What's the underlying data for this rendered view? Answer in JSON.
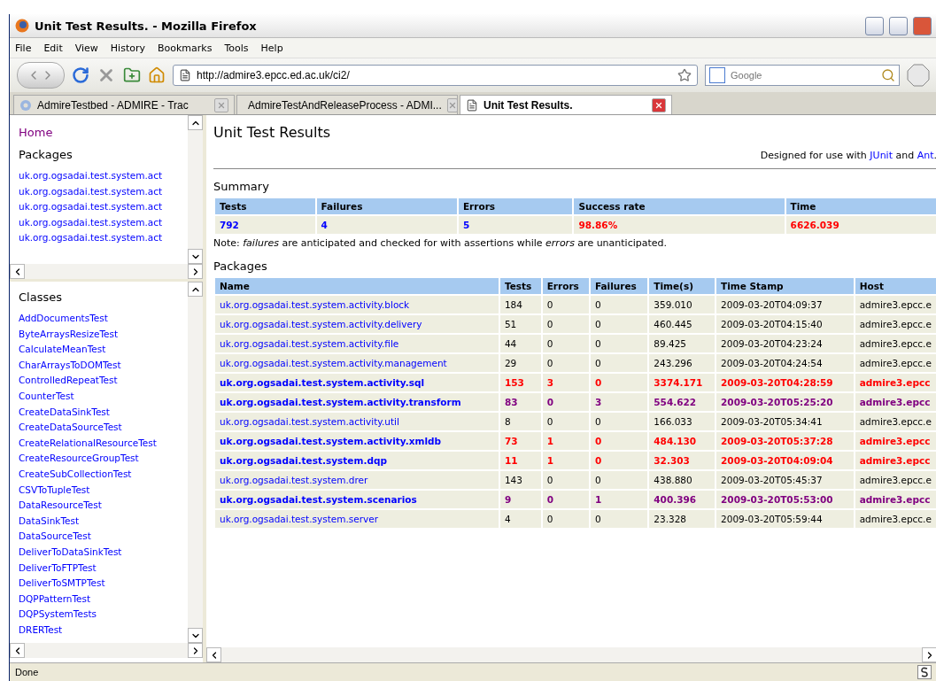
{
  "window": {
    "title": "Unit Test Results. - Mozilla Firefox"
  },
  "menu": [
    "File",
    "Edit",
    "View",
    "History",
    "Bookmarks",
    "Tools",
    "Help"
  ],
  "toolbar": {
    "url": "http://admire3.epcc.ed.ac.uk/ci2/",
    "search_placeholder": "Google"
  },
  "tabs": [
    {
      "label": "AdmireTestbed - ADMIRE - Trac",
      "selected": false
    },
    {
      "label": "AdmireTestAndReleaseProcess - ADMI...",
      "selected": false
    },
    {
      "label": "Unit Test Results.",
      "selected": true
    }
  ],
  "sidebar": {
    "home": "Home",
    "packages_heading": "Packages",
    "packages": [
      "uk.org.ogsadai.test.system.act",
      "uk.org.ogsadai.test.system.act",
      "uk.org.ogsadai.test.system.act",
      "uk.org.ogsadai.test.system.act",
      "uk.org.ogsadai.test.system.act"
    ],
    "classes_heading": "Classes",
    "classes": [
      "AddDocumentsTest",
      "ByteArraysResizeTest",
      "CalculateMeanTest",
      "CharArraysToDOMTest",
      "ControlledRepeatTest",
      "CounterTest",
      "CreateDataSinkTest",
      "CreateDataSourceTest",
      "CreateRelationalResourceTest",
      "CreateResourceGroupTest",
      "CreateSubCollectionTest",
      "CSVToTupleTest",
      "DataResourceTest",
      "DataSinkTest",
      "DataSourceTest",
      "DeliverToDataSinkTest",
      "DeliverToFTPTest",
      "DeliverToSMTPTest",
      "DQPPatternTest",
      "DQPSystemTests",
      "DRERTest"
    ]
  },
  "content": {
    "title": "Unit Test Results",
    "credit": {
      "before": "Designed for use with ",
      "link1": "JUnit",
      "middle": " and ",
      "link2": "Ant",
      "after": "."
    },
    "summary_heading": "Summary",
    "summary": {
      "columns": [
        "Tests",
        "Failures",
        "Errors",
        "Success rate",
        "Time"
      ],
      "cells": [
        {
          "text": "792",
          "kind": "count"
        },
        {
          "text": "4",
          "kind": "count"
        },
        {
          "text": "5",
          "kind": "count"
        },
        {
          "text": "98.86%",
          "kind": "alert"
        },
        {
          "text": "6626.039",
          "kind": "alert"
        }
      ]
    },
    "note": "Note: *failures* are anticipated and checked for with assertions while *errors* are unanticipated.",
    "packages_heading": "Packages",
    "packages": {
      "columns": [
        "Name",
        "Tests",
        "Errors",
        "Failures",
        "Time(s)",
        "Time Stamp",
        "Host"
      ],
      "rows": [
        {
          "name": "uk.org.ogsadai.test.system.activity.block",
          "tests": "184",
          "errors": "0",
          "failures": "0",
          "time": "359.010",
          "timestamp": "2009-03-20T04:09:37",
          "host": "admire3.epcc.e",
          "kind": "pass"
        },
        {
          "name": "uk.org.ogsadai.test.system.activity.delivery",
          "tests": "51",
          "errors": "0",
          "failures": "0",
          "time": "460.445",
          "timestamp": "2009-03-20T04:15:40",
          "host": "admire3.epcc.e",
          "kind": "pass"
        },
        {
          "name": "uk.org.ogsadai.test.system.activity.file",
          "tests": "44",
          "errors": "0",
          "failures": "0",
          "time": "89.425",
          "timestamp": "2009-03-20T04:23:24",
          "host": "admire3.epcc.e",
          "kind": "pass"
        },
        {
          "name": "uk.org.ogsadai.test.system.activity.management",
          "tests": "29",
          "errors": "0",
          "failures": "0",
          "time": "243.296",
          "timestamp": "2009-03-20T04:24:54",
          "host": "admire3.epcc.e",
          "kind": "pass"
        },
        {
          "name": "uk.org.ogsadai.test.system.activity.sql",
          "tests": "153",
          "errors": "3",
          "failures": "0",
          "time": "3374.171",
          "timestamp": "2009-03-20T04:28:59",
          "host": "admire3.epcc",
          "kind": "error"
        },
        {
          "name": "uk.org.ogsadai.test.system.activity.transform",
          "tests": "83",
          "errors": "0",
          "failures": "3",
          "time": "554.622",
          "timestamp": "2009-03-20T05:25:20",
          "host": "admire3.epcc",
          "kind": "failure"
        },
        {
          "name": "uk.org.ogsadai.test.system.activity.util",
          "tests": "8",
          "errors": "0",
          "failures": "0",
          "time": "166.033",
          "timestamp": "2009-03-20T05:34:41",
          "host": "admire3.epcc.e",
          "kind": "pass"
        },
        {
          "name": "uk.org.ogsadai.test.system.activity.xmldb",
          "tests": "73",
          "errors": "1",
          "failures": "0",
          "time": "484.130",
          "timestamp": "2009-03-20T05:37:28",
          "host": "admire3.epcc",
          "kind": "error"
        },
        {
          "name": "uk.org.ogsadai.test.system.dqp",
          "tests": "11",
          "errors": "1",
          "failures": "0",
          "time": "32.303",
          "timestamp": "2009-03-20T04:09:04",
          "host": "admire3.epcc",
          "kind": "error"
        },
        {
          "name": "uk.org.ogsadai.test.system.drer",
          "tests": "143",
          "errors": "0",
          "failures": "0",
          "time": "438.880",
          "timestamp": "2009-03-20T05:45:37",
          "host": "admire3.epcc.e",
          "kind": "pass"
        },
        {
          "name": "uk.org.ogsadai.test.system.scenarios",
          "tests": "9",
          "errors": "0",
          "failures": "1",
          "time": "400.396",
          "timestamp": "2009-03-20T05:53:00",
          "host": "admire3.epcc",
          "kind": "failure"
        },
        {
          "name": "uk.org.ogsadai.test.system.server",
          "tests": "4",
          "errors": "0",
          "failures": "0",
          "time": "23.328",
          "timestamp": "2009-03-20T05:59:44",
          "host": "admire3.epcc.e",
          "kind": "pass"
        }
      ]
    }
  },
  "status_bar": {
    "text": "Done"
  }
}
